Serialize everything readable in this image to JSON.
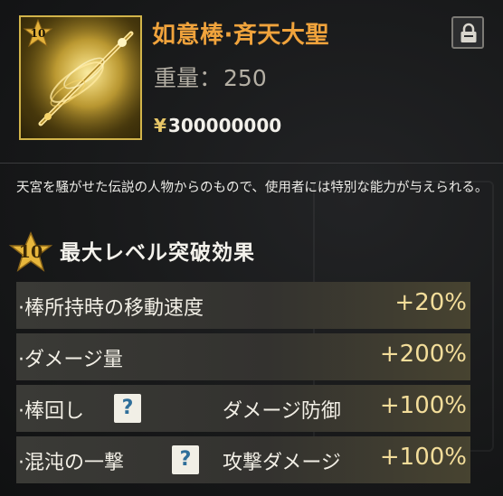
{
  "item": {
    "name": "如意棒·斉天大聖",
    "level": "10",
    "weight_label": "重量：",
    "weight_value": "250",
    "price_symbol": "¥",
    "price": "300000000"
  },
  "description": "天宮を騒がせた伝説の人物からのもので、使用者には特別な能力が与えられる。",
  "section": {
    "level": "10",
    "title": "最大レベル突破効果"
  },
  "effects": [
    {
      "label": "·棒所持時の移動速度",
      "value": "+20%"
    },
    {
      "label": "·ダメージ量",
      "value": "+200%"
    },
    {
      "label": "·棒回し",
      "sub": "ダメージ防御",
      "value": "+100%",
      "help": "?"
    },
    {
      "label": "·混沌の一撃",
      "sub": "攻撃ダメージ",
      "value": "+100%",
      "help": "?"
    }
  ],
  "icons": {
    "lock": "lock-icon",
    "help": "help-icon",
    "star": "star-badge-icon"
  },
  "colors": {
    "item_name": "#f0a33c",
    "value_text": "#f3dd9a",
    "badge_gold": "#e4b23a"
  }
}
